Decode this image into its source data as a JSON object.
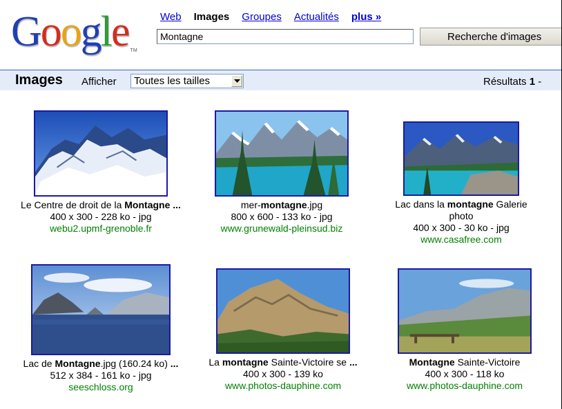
{
  "header": {
    "logo": "Google",
    "logo_tm": "TM",
    "nav": [
      {
        "label": "Web",
        "active": false
      },
      {
        "label": "Images",
        "active": true
      },
      {
        "label": "Groupes",
        "active": false
      },
      {
        "label": "Actualités",
        "active": false
      },
      {
        "label": "plus »",
        "active": false
      }
    ],
    "search_value": "Montagne",
    "search_button": "Recherche d'images"
  },
  "bar": {
    "title": "Images",
    "show_label": "Afficher",
    "size_select_value": "Toutes les tailles",
    "results_prefix": "Résultats ",
    "results_bold": "1",
    "results_suffix": " -"
  },
  "results": [
    {
      "caption_parts": [
        {
          "text": "Le Centre de droit de la ",
          "bold": false
        },
        {
          "text": "Montagne ...",
          "bold": true
        }
      ],
      "meta": "400 x 300 - 228 ko - jpg",
      "site": "webu2.upmf-grenoble.fr",
      "image_icon": "snowy-mountain-image"
    },
    {
      "caption_parts": [
        {
          "text": "mer-",
          "bold": false
        },
        {
          "text": "montagne",
          "bold": true
        },
        {
          "text": ".jpg",
          "bold": false
        }
      ],
      "meta": "800 x 600 - 133 ko - jpg",
      "site": "www.grunewald-pleinsud.biz",
      "image_icon": "mountain-lake-pines-image"
    },
    {
      "caption_parts": [
        {
          "text": "Lac dans la ",
          "bold": false
        },
        {
          "text": "montagne",
          "bold": true
        },
        {
          "text": " Galerie photo",
          "bold": false
        }
      ],
      "meta": "400 x 300 - 30 ko - jpg",
      "site": "www.casafree.com",
      "image_icon": "turquoise-lake-image"
    },
    {
      "caption_parts": [
        {
          "text": "Lac de ",
          "bold": false
        },
        {
          "text": "Montagne",
          "bold": true
        },
        {
          "text": ".jpg (160.24 ko) ",
          "bold": false
        },
        {
          "text": "...",
          "bold": true
        }
      ],
      "meta": "512 x 384 - 161 ko - jpg",
      "site": "seeschloss.org",
      "image_icon": "fjord-lake-image"
    },
    {
      "caption_parts": [
        {
          "text": "La ",
          "bold": false
        },
        {
          "text": "montagne",
          "bold": true
        },
        {
          "text": " Sainte-Victoire se ",
          "bold": false
        },
        {
          "text": "...",
          "bold": true
        }
      ],
      "meta": "400 x 300 - 139 ko",
      "site": "www.photos-dauphine.com",
      "image_icon": "rocky-cliff-image"
    },
    {
      "caption_parts": [
        {
          "text": "Montagne",
          "bold": true
        },
        {
          "text": " Sainte-Victoire",
          "bold": false
        }
      ],
      "meta": "400 x 300 - 118 ko",
      "site": "www.photos-dauphine.com",
      "image_icon": "mountain-bench-image"
    }
  ]
}
